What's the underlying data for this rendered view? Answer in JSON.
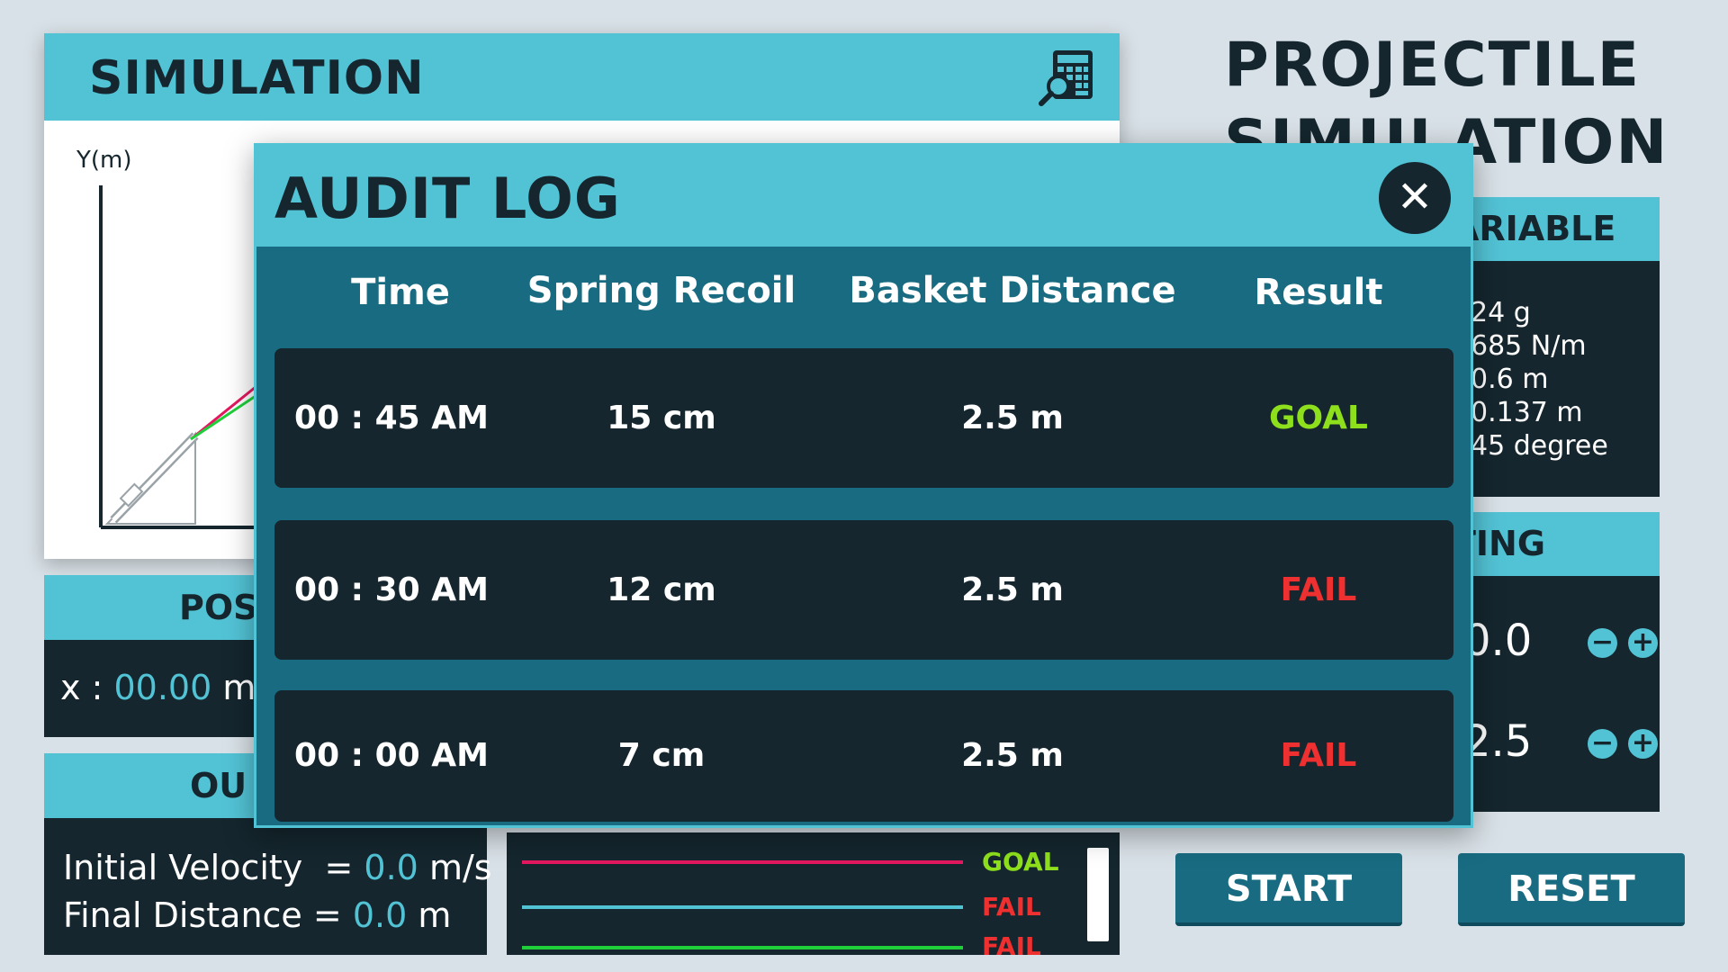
{
  "app_title": [
    "PROJECTILE",
    "SIMULATION"
  ],
  "simulation": {
    "title": "SIMULATION",
    "icon": "calculator-search-icon",
    "y_axis_label": "Y(m)"
  },
  "position": {
    "header": "POS",
    "x_label": "x :",
    "x_value": "00.00",
    "x_unit": "m"
  },
  "output": {
    "header": "OU",
    "initial_velocity_label": "Initial Velocity",
    "eq": "=",
    "initial_velocity_value": "0.0",
    "initial_velocity_unit": "m/s",
    "final_distance_label": "Final Distance",
    "final_distance_value": "0.0",
    "final_distance_unit": "m"
  },
  "legend": {
    "items": [
      {
        "label": "GOAL",
        "color": "#e3185f",
        "label_color": "#8ee01c"
      },
      {
        "label": "FAIL",
        "color": "#52c3d5",
        "label_color": "#ee3030"
      },
      {
        "label": "FAIL",
        "color": "#1ecf3a",
        "label_color": "#ee3030"
      }
    ]
  },
  "variables": {
    "header": "ARIABLE",
    "values": [
      "24 g",
      "685 N/m",
      "0.6 m",
      "0.137 m",
      "45 degree"
    ]
  },
  "setting": {
    "header": "TING",
    "rows": [
      {
        "value": "0.0"
      },
      {
        "value": "2.5"
      }
    ],
    "minus": "−",
    "plus": "+"
  },
  "buttons": {
    "start": "START",
    "reset": "RESET"
  },
  "audit_log": {
    "title": "AUDIT LOG",
    "close": "✕",
    "columns": [
      "Time",
      "Spring Recoil",
      "Basket Distance",
      "Result"
    ],
    "rows": [
      {
        "time": "00 : 45 AM",
        "recoil": "15 cm",
        "distance": "2.5 m",
        "result": "GOAL",
        "result_color": "#8ee01c"
      },
      {
        "time": "00 : 30 AM",
        "recoil": "12 cm",
        "distance": "2.5 m",
        "result": "FAIL",
        "result_color": "#ee3030"
      },
      {
        "time": "00 : 00 AM",
        "recoil": "7 cm",
        "distance": "2.5 m",
        "result": "FAIL",
        "result_color": "#ee3030"
      }
    ]
  },
  "colors": {
    "accent": "#52c3d5",
    "dark": "#15262e",
    "button": "#186b80",
    "goal": "#8ee01c",
    "fail": "#ee3030"
  }
}
